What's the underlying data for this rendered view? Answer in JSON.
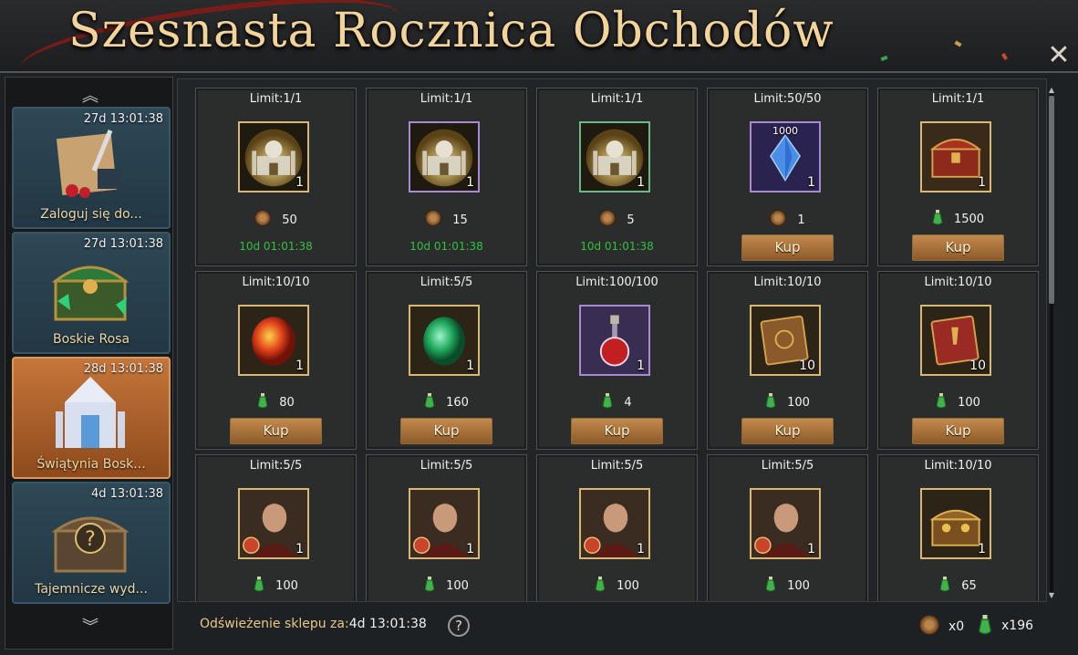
{
  "header": {
    "title": "Szesnasta Rocznica Obchodów",
    "close_glyph": "✕"
  },
  "sidebar": {
    "up_glyph": "︽",
    "down_glyph": "︾",
    "items": [
      {
        "time": "27d 13:01:38",
        "label": "Zaloguj się do...",
        "icon": "scroll-quill-icon",
        "active": false
      },
      {
        "time": "27d 13:01:38",
        "label": "Boskie Rosa",
        "icon": "emerald-chest-icon",
        "active": false
      },
      {
        "time": "28d 13:01:38",
        "label": "Świątynia Bosk...",
        "icon": "temple-icon",
        "active": true
      },
      {
        "time": "4d 13:01:38",
        "label": "Tajemnicze wyd...",
        "icon": "mystery-chest-icon",
        "active": false
      }
    ]
  },
  "shop": {
    "buy_label": "Kup",
    "items": [
      {
        "limit": "Limit:1/1",
        "icon": "golden-palace-icon",
        "frame": "gold",
        "qty": "1",
        "currency": "coin",
        "price": "50",
        "timer": "10d 01:01:38",
        "buy": false
      },
      {
        "limit": "Limit:1/1",
        "icon": "golden-palace-icon",
        "frame": "purple",
        "qty": "1",
        "currency": "coin",
        "price": "15",
        "timer": "10d 01:01:38",
        "buy": false
      },
      {
        "limit": "Limit:1/1",
        "icon": "golden-palace-icon",
        "frame": "green",
        "qty": "1",
        "currency": "coin",
        "price": "5",
        "timer": "10d 01:01:38",
        "buy": false
      },
      {
        "limit": "Limit:50/50",
        "icon": "blue-crystal-icon",
        "frame": "purple",
        "qty": "1",
        "badge": "1000",
        "currency": "coin",
        "price": "1",
        "timer": "",
        "buy": true
      },
      {
        "limit": "Limit:1/1",
        "icon": "red-chest-icon",
        "frame": "gold",
        "qty": "1",
        "currency": "potion",
        "price": "1500",
        "timer": "",
        "buy": true
      },
      {
        "limit": "Limit:10/10",
        "icon": "fire-gem-icon",
        "frame": "gold",
        "qty": "1",
        "currency": "potion",
        "price": "80",
        "timer": "",
        "buy": true
      },
      {
        "limit": "Limit:5/5",
        "icon": "emerald-gem-icon",
        "frame": "gold",
        "qty": "1",
        "currency": "potion",
        "price": "160",
        "timer": "",
        "buy": true
      },
      {
        "limit": "Limit:100/100",
        "icon": "red-potion-icon",
        "frame": "purple",
        "qty": "1",
        "currency": "potion",
        "price": "4",
        "timer": "",
        "buy": true
      },
      {
        "limit": "Limit:10/10",
        "icon": "brown-tome-icon",
        "frame": "gold",
        "qty": "10",
        "currency": "potion",
        "price": "100",
        "timer": "",
        "buy": true
      },
      {
        "limit": "Limit:10/10",
        "icon": "red-tome-icon",
        "frame": "gold",
        "qty": "10",
        "currency": "potion",
        "price": "100",
        "timer": "",
        "buy": true
      },
      {
        "limit": "Limit:5/5",
        "icon": "hero-portrait-icon",
        "frame": "gold",
        "qty": "1",
        "currency": "potion",
        "price": "100",
        "timer": "",
        "buy": false
      },
      {
        "limit": "Limit:5/5",
        "icon": "hero-portrait-icon",
        "frame": "gold",
        "qty": "1",
        "currency": "potion",
        "price": "100",
        "timer": "",
        "buy": false
      },
      {
        "limit": "Limit:5/5",
        "icon": "hero-portrait-icon",
        "frame": "gold",
        "qty": "1",
        "currency": "potion",
        "price": "100",
        "timer": "",
        "buy": false
      },
      {
        "limit": "Limit:5/5",
        "icon": "hero-portrait-icon",
        "frame": "gold",
        "qty": "1",
        "currency": "potion",
        "price": "100",
        "timer": "",
        "buy": false
      },
      {
        "limit": "Limit:10/10",
        "icon": "treasure-chest-icon",
        "frame": "gold",
        "qty": "1",
        "currency": "potion",
        "price": "65",
        "timer": "",
        "buy": false
      }
    ]
  },
  "footer": {
    "refresh_label": "Odświeżenie sklepu za:",
    "refresh_time": "4d 13:01:38",
    "help_glyph": "?",
    "coin_count": "x0",
    "potion_count": "x196"
  },
  "colors": {
    "accent": "#f2d49a",
    "timer": "#31c23f",
    "buy": "#b07a40",
    "active_tab": "#c5763a"
  }
}
